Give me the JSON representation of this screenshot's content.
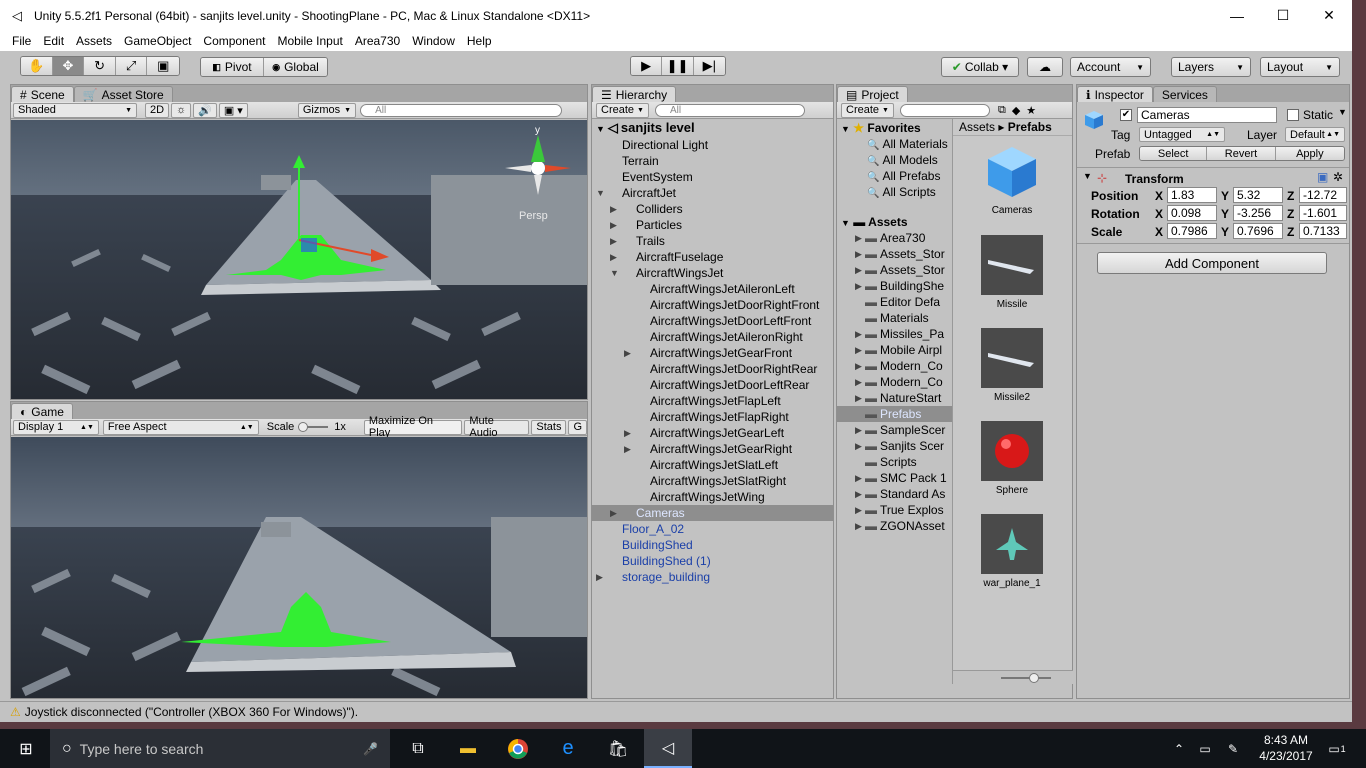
{
  "window": {
    "title": "Unity 5.5.2f1 Personal (64bit) - sanjits level.unity - ShootingPlane - PC, Mac & Linux Standalone <DX11>",
    "minimize": "—",
    "maximize": "☐",
    "close": "✕"
  },
  "menu": [
    "File",
    "Edit",
    "Assets",
    "GameObject",
    "Component",
    "Mobile Input",
    "Area730",
    "Window",
    "Help"
  ],
  "toolbar": {
    "pivot": "Pivot",
    "global": "Global",
    "collab": "Collab ▾",
    "account": "Account",
    "layers": "Layers",
    "layout": "Layout"
  },
  "scene": {
    "tab_scene": "Scene",
    "tab_asset_store": "Asset Store",
    "shading": "Shaded",
    "mode_2d": "2D",
    "gizmos": "Gizmos",
    "search_placeholder": "All",
    "gizmo_label": "Persp",
    "gizmo_axis_y": "y"
  },
  "game": {
    "tab": "Game",
    "display": "Display 1",
    "aspect": "Free Aspect",
    "scale_label": "Scale",
    "scale_value": "1x",
    "maximize": "Maximize On Play",
    "mute": "Mute Audio",
    "stats": "Stats",
    "gizmos": "G"
  },
  "hierarchy": {
    "tab": "Hierarchy",
    "create": "Create",
    "search_placeholder": "All",
    "scene_name": "sanjits level",
    "items": [
      {
        "label": "Directional Light",
        "depth": 1,
        "arrow": "",
        "blue": false,
        "selected": false
      },
      {
        "label": "Terrain",
        "depth": 1,
        "arrow": "",
        "blue": false,
        "selected": false
      },
      {
        "label": "EventSystem",
        "depth": 1,
        "arrow": "",
        "blue": false,
        "selected": false
      },
      {
        "label": "AircraftJet",
        "depth": 1,
        "arrow": "▼",
        "blue": false,
        "selected": false
      },
      {
        "label": "Colliders",
        "depth": 2,
        "arrow": "▶",
        "blue": false,
        "selected": false
      },
      {
        "label": "Particles",
        "depth": 2,
        "arrow": "▶",
        "blue": false,
        "selected": false
      },
      {
        "label": "Trails",
        "depth": 2,
        "arrow": "▶",
        "blue": false,
        "selected": false
      },
      {
        "label": "AircraftFuselage",
        "depth": 2,
        "arrow": "▶",
        "blue": false,
        "selected": false
      },
      {
        "label": "AircraftWingsJet",
        "depth": 2,
        "arrow": "▼",
        "blue": false,
        "selected": false
      },
      {
        "label": "AircraftWingsJetAileronLeft",
        "depth": 3,
        "arrow": "",
        "blue": false,
        "selected": false
      },
      {
        "label": "AircraftWingsJetDoorRightFront",
        "depth": 3,
        "arrow": "",
        "blue": false,
        "selected": false
      },
      {
        "label": "AircraftWingsJetDoorLeftFront",
        "depth": 3,
        "arrow": "",
        "blue": false,
        "selected": false
      },
      {
        "label": "AircraftWingsJetAileronRight",
        "depth": 3,
        "arrow": "",
        "blue": false,
        "selected": false
      },
      {
        "label": "AircraftWingsJetGearFront",
        "depth": 3,
        "arrow": "▶",
        "blue": false,
        "selected": false
      },
      {
        "label": "AircraftWingsJetDoorRightRear",
        "depth": 3,
        "arrow": "",
        "blue": false,
        "selected": false
      },
      {
        "label": "AircraftWingsJetDoorLeftRear",
        "depth": 3,
        "arrow": "",
        "blue": false,
        "selected": false
      },
      {
        "label": "AircraftWingsJetFlapLeft",
        "depth": 3,
        "arrow": "",
        "blue": false,
        "selected": false
      },
      {
        "label": "AircraftWingsJetFlapRight",
        "depth": 3,
        "arrow": "",
        "blue": false,
        "selected": false
      },
      {
        "label": "AircraftWingsJetGearLeft",
        "depth": 3,
        "arrow": "▶",
        "blue": false,
        "selected": false
      },
      {
        "label": "AircraftWingsJetGearRight",
        "depth": 3,
        "arrow": "▶",
        "blue": false,
        "selected": false
      },
      {
        "label": "AircraftWingsJetSlatLeft",
        "depth": 3,
        "arrow": "",
        "blue": false,
        "selected": false
      },
      {
        "label": "AircraftWingsJetSlatRight",
        "depth": 3,
        "arrow": "",
        "blue": false,
        "selected": false
      },
      {
        "label": "AircraftWingsJetWing",
        "depth": 3,
        "arrow": "",
        "blue": false,
        "selected": false
      },
      {
        "label": "Cameras",
        "depth": 2,
        "arrow": "▶",
        "blue": true,
        "selected": true
      },
      {
        "label": "Floor_A_02",
        "depth": 1,
        "arrow": "",
        "blue": true,
        "selected": false
      },
      {
        "label": "BuildingShed",
        "depth": 1,
        "arrow": "",
        "blue": true,
        "selected": false
      },
      {
        "label": "BuildingShed (1)",
        "depth": 1,
        "arrow": "",
        "blue": true,
        "selected": false
      },
      {
        "label": "storage_building",
        "depth": 1,
        "arrow": "▶",
        "blue": true,
        "selected": false
      }
    ]
  },
  "project": {
    "tab": "Project",
    "create": "Create",
    "favorites_label": "Favorites",
    "favorites": [
      "All Materials",
      "All Models",
      "All Prefabs",
      "All Scripts"
    ],
    "assets_label": "Assets",
    "folders": [
      {
        "label": "Area730",
        "arrow": "▶"
      },
      {
        "label": "Assets_Stor",
        "arrow": "▶"
      },
      {
        "label": "Assets_Stor",
        "arrow": "▶"
      },
      {
        "label": "BuildingShe",
        "arrow": "▶"
      },
      {
        "label": "Editor Defa",
        "arrow": ""
      },
      {
        "label": "Materials",
        "arrow": ""
      },
      {
        "label": "Missiles_Pa",
        "arrow": "▶"
      },
      {
        "label": "Mobile Airpl",
        "arrow": "▶"
      },
      {
        "label": "Modern_Co",
        "arrow": "▶"
      },
      {
        "label": "Modern_Co",
        "arrow": "▶"
      },
      {
        "label": "NatureStart",
        "arrow": "▶"
      },
      {
        "label": "Prefabs",
        "arrow": ""
      },
      {
        "label": "SampleScer",
        "arrow": "▶"
      },
      {
        "label": "Sanjits Scer",
        "arrow": "▶"
      },
      {
        "label": "Scripts",
        "arrow": ""
      },
      {
        "label": "SMC Pack 1",
        "arrow": "▶"
      },
      {
        "label": "Standard As",
        "arrow": "▶"
      },
      {
        "label": "True Explos",
        "arrow": "▶"
      },
      {
        "label": "ZGONAsset",
        "arrow": "▶"
      }
    ],
    "selected_folder": "Prefabs",
    "breadcrumb_root": "Assets",
    "breadcrumb_sep": "▸",
    "breadcrumb_current": "Prefabs",
    "items": [
      "Cameras",
      "Missile",
      "Missile2",
      "Sphere",
      "war_plane_1"
    ]
  },
  "inspector": {
    "tab": "Inspector",
    "tab2": "Services",
    "name": "Cameras",
    "static_label": "Static",
    "tag_label": "Tag",
    "tag_value": "Untagged",
    "layer_label": "Layer",
    "layer_value": "Default",
    "prefab_label": "Prefab",
    "select": "Select",
    "revert": "Revert",
    "apply": "Apply",
    "transform_label": "Transform",
    "position_label": "Position",
    "rotation_label": "Rotation",
    "scale_label": "Scale",
    "x_label": "X",
    "y_label": "Y",
    "z_label": "Z",
    "position": {
      "x": "1.83",
      "y": "5.32",
      "z": "-12.72"
    },
    "rotation": {
      "x": "0.098",
      "y": "-3.256",
      "z": "-1.601"
    },
    "scale": {
      "x": "0.7986",
      "y": "0.7696",
      "z": "0.7133"
    },
    "add_component": "Add Component"
  },
  "status": {
    "message": "Joystick disconnected (\"Controller (XBOX 360 For Windows)\")."
  },
  "taskbar": {
    "search_placeholder": "Type here to search",
    "time": "8:43 AM",
    "date": "4/23/2017",
    "notifications": "1"
  },
  "colors": {
    "editor_bg": "#c2c2c2",
    "selection": "#8e8e8e",
    "prefab_blue": "#1a3fa8",
    "aircraft_green": "#33ee33",
    "taskbar": "#101418"
  }
}
